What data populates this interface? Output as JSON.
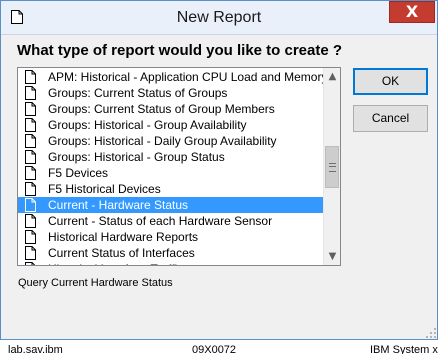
{
  "window": {
    "title": "New Report",
    "close_glyph": "X",
    "icon": "document-icon"
  },
  "question": "What type of report would you like to create ?",
  "report_list": {
    "items": [
      {
        "label": "APM: Historical - Application CPU Load and Memory",
        "selected": false
      },
      {
        "label": "Groups: Current Status of Groups",
        "selected": false
      },
      {
        "label": "Groups: Current Status of Group Members",
        "selected": false
      },
      {
        "label": "Groups: Historical - Group Availability",
        "selected": false
      },
      {
        "label": "Groups: Historical - Daily Group Availability",
        "selected": false
      },
      {
        "label": "Groups: Historical - Group Status",
        "selected": false
      },
      {
        "label": "F5 Devices",
        "selected": false
      },
      {
        "label": "F5 Historical Devices",
        "selected": false
      },
      {
        "label": "Current - Hardware Status",
        "selected": true
      },
      {
        "label": "Current - Status of each Hardware Sensor",
        "selected": false
      },
      {
        "label": "Historical Hardware Reports",
        "selected": false
      },
      {
        "label": "Current Status of Interfaces",
        "selected": false
      },
      {
        "label": "Historical Interface Traffic",
        "selected": false
      }
    ]
  },
  "buttons": {
    "ok_label": "OK",
    "cancel_label": "Cancel"
  },
  "status_text": "Query Current Hardware Status",
  "background_text": {
    "left": "lab.sav.ibm",
    "middle": "09X0072",
    "right": "IBM System x"
  },
  "colors": {
    "selection": "#3399ff",
    "close_button": "#c43b2f",
    "titlebar": "#e9f0f9"
  }
}
